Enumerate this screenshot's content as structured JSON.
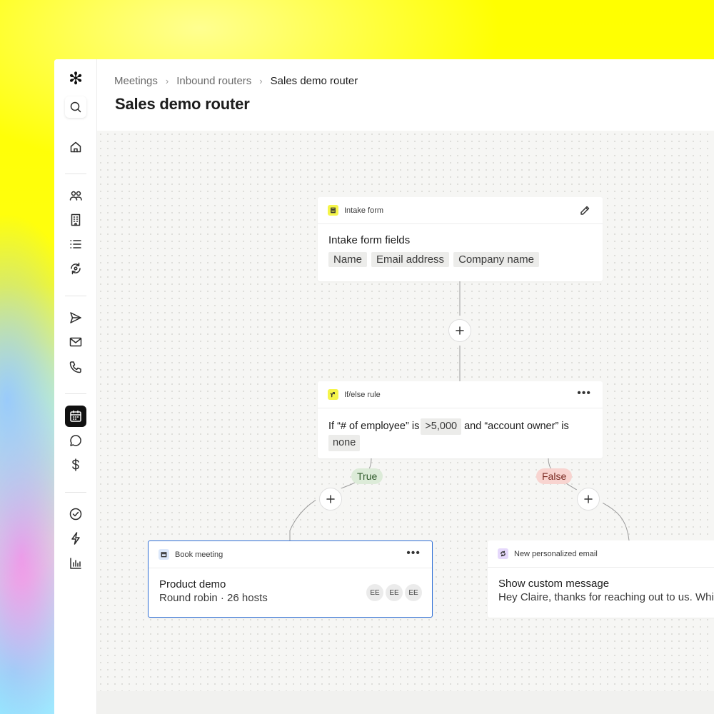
{
  "brand": {
    "logo_glyph": "✻"
  },
  "sidebar": {
    "items": [
      {
        "name": "search",
        "icon": "search-icon"
      },
      {
        "name": "home",
        "icon": "home-icon"
      },
      {
        "name": "people",
        "icon": "people-icon"
      },
      {
        "name": "companies",
        "icon": "building-icon"
      },
      {
        "name": "lists",
        "icon": "list-icon"
      },
      {
        "name": "sync",
        "icon": "sync-icon"
      },
      {
        "name": "sequences",
        "icon": "send-icon"
      },
      {
        "name": "email",
        "icon": "mail-icon"
      },
      {
        "name": "calls",
        "icon": "phone-icon"
      },
      {
        "name": "meetings",
        "icon": "calendar-icon",
        "active": true
      },
      {
        "name": "conversations",
        "icon": "chat-icon"
      },
      {
        "name": "deals",
        "icon": "dollar-icon"
      },
      {
        "name": "tasks",
        "icon": "check-circle-icon"
      },
      {
        "name": "workflows",
        "icon": "bolt-icon"
      },
      {
        "name": "analytics",
        "icon": "bar-chart-icon"
      }
    ]
  },
  "header": {
    "breadcrumb": [
      "Meetings",
      "Inbound routers",
      "Sales demo router"
    ],
    "title": "Sales demo router"
  },
  "nodes": {
    "intake": {
      "type_label": "Intake form",
      "title": "Intake form fields",
      "fields": [
        "Name",
        "Email address",
        "Company name"
      ],
      "badge_color": "#f5f54a"
    },
    "rule": {
      "type_label": "If/else rule",
      "text_1": "If “# of employee” is",
      "chip_1": ">5,000",
      "text_2": "and “account owner” is",
      "chip_2": "none",
      "badge_color": "#f5f54a"
    },
    "book": {
      "type_label": "Book meeting",
      "title": "Product demo",
      "subtitle": "Round robin · 26 hosts",
      "hosts": [
        "EE",
        "EE",
        "EE"
      ],
      "badge_color": "#dce8fb",
      "border_color": "#2f6fd6"
    },
    "email": {
      "type_label": "New personalized email",
      "title": "Show custom message",
      "subtitle": "Hey Claire, thanks for reaching out to us. While",
      "badge_color": "#e5d8fb"
    }
  },
  "branches": {
    "true_label": "True",
    "false_label": "False"
  },
  "colors": {
    "accent_yellow": "#ffff00",
    "canvas": "#f6f6f4",
    "true_bg": "#dcebd8",
    "false_bg": "#f8d4d0"
  }
}
